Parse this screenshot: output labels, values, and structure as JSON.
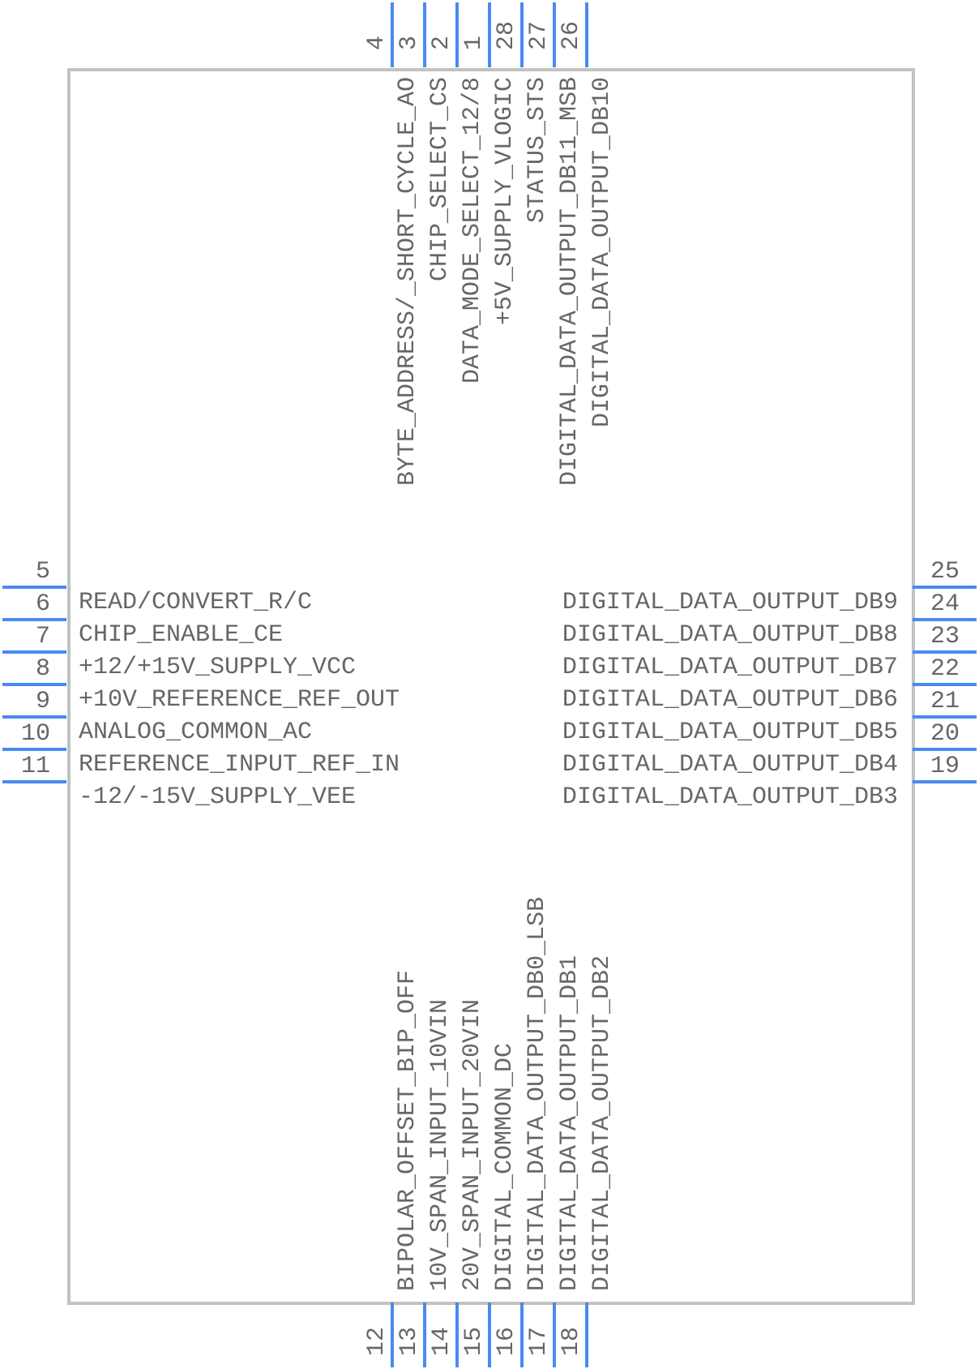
{
  "component": {
    "colors": {
      "pin": "#4a8af0",
      "outline": "#c2c2c2",
      "text": "#666666"
    }
  },
  "left_pins": [
    {
      "number": "5",
      "label": "READ/CONVERT_R/C",
      "overbar": "C"
    },
    {
      "number": "6",
      "label": "CHIP_ENABLE_CE"
    },
    {
      "number": "7",
      "label": "+12/+15V_SUPPLY_VCC"
    },
    {
      "number": "8",
      "label": "+10V_REFERENCE_REF_OUT"
    },
    {
      "number": "9",
      "label": "ANALOG_COMMON_AC"
    },
    {
      "number": "10",
      "label": "REFERENCE_INPUT_REF_IN"
    },
    {
      "number": "11",
      "label": "-12/-15V_SUPPLY_VEE"
    }
  ],
  "right_pins": [
    {
      "number": "25",
      "label": "DIGITAL_DATA_OUTPUT_DB9"
    },
    {
      "number": "24",
      "label": "DIGITAL_DATA_OUTPUT_DB8"
    },
    {
      "number": "23",
      "label": "DIGITAL_DATA_OUTPUT_DB7"
    },
    {
      "number": "22",
      "label": "DIGITAL_DATA_OUTPUT_DB6"
    },
    {
      "number": "21",
      "label": "DIGITAL_DATA_OUTPUT_DB5"
    },
    {
      "number": "20",
      "label": "DIGITAL_DATA_OUTPUT_DB4"
    },
    {
      "number": "19",
      "label": "DIGITAL_DATA_OUTPUT_DB3"
    }
  ],
  "top_pins": [
    {
      "number": "4",
      "label": "BYTE_ADDRESS/_SHORT_CYCLE_AO",
      "overbar": "O"
    },
    {
      "number": "3",
      "label": "CHIP_SELECT_CS",
      "overbar": "CS"
    },
    {
      "number": "2",
      "label": "DATA_MODE_SELECT_12/8",
      "overbar": "8"
    },
    {
      "number": "1",
      "label": "+5V_SUPPLY_VLOGIC"
    },
    {
      "number": "28",
      "label": "STATUS_STS"
    },
    {
      "number": "27",
      "label": "DIGITAL_DATA_OUTPUT_DB11_MSB"
    },
    {
      "number": "26",
      "label": "DIGITAL_DATA_OUTPUT_DB10"
    }
  ],
  "bottom_pins": [
    {
      "number": "12",
      "label": "BIPOLAR_OFFSET_BIP_OFF"
    },
    {
      "number": "13",
      "label": "10V_SPAN_INPUT_10VIN"
    },
    {
      "number": "14",
      "label": "20V_SPAN_INPUT_20VIN"
    },
    {
      "number": "15",
      "label": "DIGITAL_COMMON_DC"
    },
    {
      "number": "16",
      "label": "DIGITAL_DATA_OUTPUT_DB0_LSB"
    },
    {
      "number": "17",
      "label": "DIGITAL_DATA_OUTPUT_DB1"
    },
    {
      "number": "18",
      "label": "DIGITAL_DATA_OUTPUT_DB2"
    }
  ]
}
